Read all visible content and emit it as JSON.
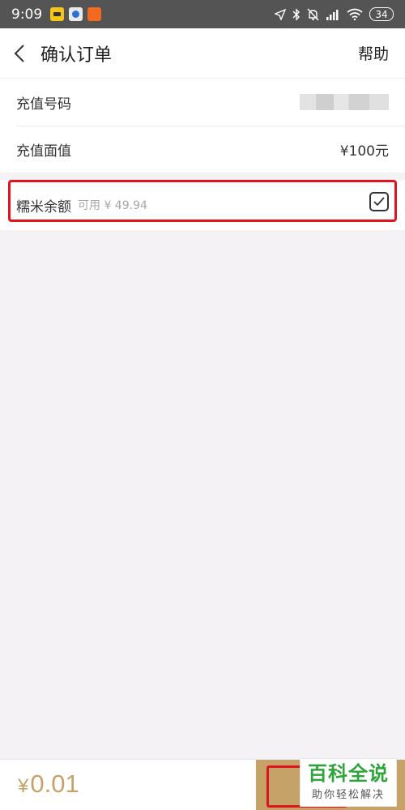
{
  "status_bar": {
    "time": "9:09",
    "battery": "34"
  },
  "header": {
    "title": "确认订单",
    "help_label": "帮助"
  },
  "order": {
    "recharge_number_label": "充值号码",
    "face_value_label": "充值面值",
    "face_value": "¥100元"
  },
  "balance": {
    "label": "糯米余额",
    "available": "可用 ¥ 49.94",
    "checked": true
  },
  "footer": {
    "total_symbol": "¥",
    "total_amount": "0.01"
  },
  "watermark": {
    "main": "百科全说",
    "sub": "助你轻松解决"
  },
  "colors": {
    "accent": "#c5a267",
    "highlight": "#e0141e",
    "watermark_green": "#2ea43a"
  }
}
